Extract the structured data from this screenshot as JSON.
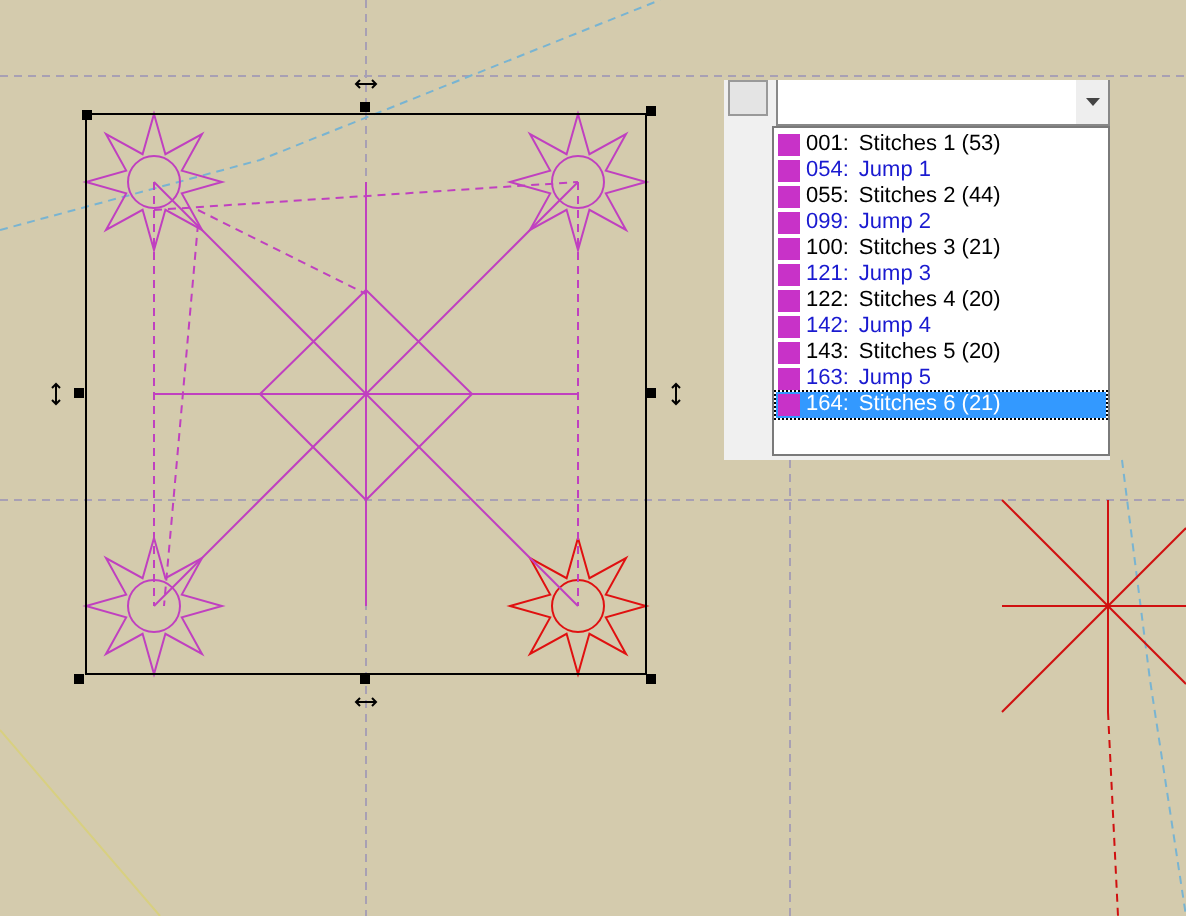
{
  "stitch_list": {
    "items": [
      {
        "kind": "stitch",
        "number": "001:",
        "label": "Stitches 1 (53)",
        "color": "#c832c8",
        "selected": false
      },
      {
        "kind": "jump",
        "number": "054:",
        "label": "Jump 1",
        "color": "#c832c8",
        "selected": false
      },
      {
        "kind": "stitch",
        "number": "055:",
        "label": "Stitches 2 (44)",
        "color": "#c832c8",
        "selected": false
      },
      {
        "kind": "jump",
        "number": "099:",
        "label": "Jump 2",
        "color": "#c832c8",
        "selected": false
      },
      {
        "kind": "stitch",
        "number": "100:",
        "label": "Stitches 3 (21)",
        "color": "#c832c8",
        "selected": false
      },
      {
        "kind": "jump",
        "number": "121:",
        "label": "Jump 3",
        "color": "#c832c8",
        "selected": false
      },
      {
        "kind": "stitch",
        "number": "122:",
        "label": "Stitches 4 (20)",
        "color": "#c832c8",
        "selected": false
      },
      {
        "kind": "jump",
        "number": "142:",
        "label": "Jump 4",
        "color": "#c832c8",
        "selected": false
      },
      {
        "kind": "stitch",
        "number": "143:",
        "label": "Stitches 5 (20)",
        "color": "#c832c8",
        "selected": false
      },
      {
        "kind": "jump",
        "number": "163:",
        "label": "Jump 5",
        "color": "#c832c8",
        "selected": false
      },
      {
        "kind": "stitch",
        "number": "164:",
        "label": "Stitches 6 (21)",
        "color": "#c832c8",
        "selected": true
      }
    ]
  }
}
